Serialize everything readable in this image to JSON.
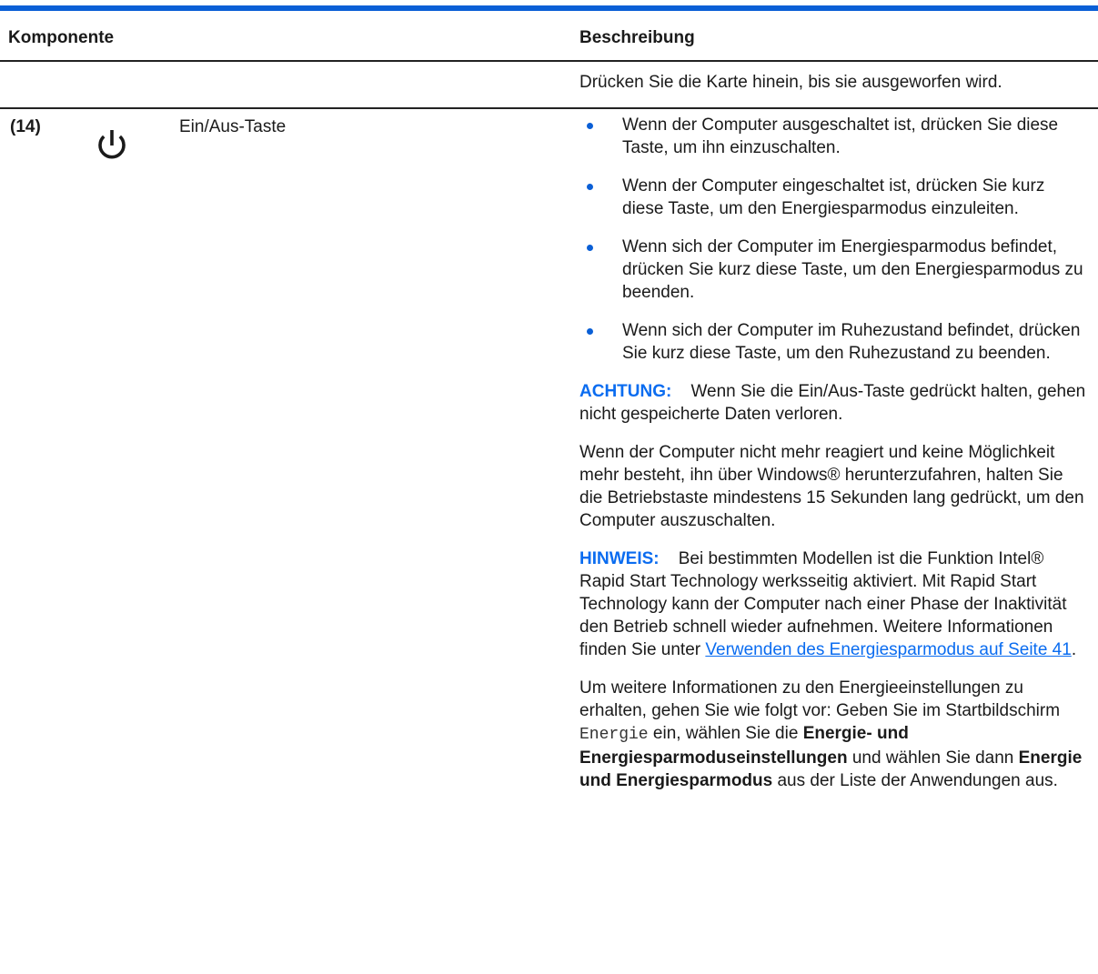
{
  "table": {
    "header": {
      "component": "Komponente",
      "description": "Beschreibung"
    },
    "intro_row": {
      "description": "Drücken Sie die Karte hinein, bis sie ausgeworfen wird."
    },
    "row": {
      "number": "(14)",
      "icon": "power-icon",
      "name": "Ein/Aus-Taste",
      "bullets": [
        "Wenn der Computer ausgeschaltet ist, drücken Sie diese Taste, um ihn einzuschalten.",
        "Wenn der Computer eingeschaltet ist, drücken Sie kurz diese Taste, um den Energiesparmodus einzuleiten.",
        "Wenn sich der Computer im Energiesparmodus befindet, drücken Sie kurz diese Taste, um den Energiesparmodus zu beenden.",
        "Wenn sich der Computer im Ruhezustand befindet, drücken Sie kurz diese Taste, um den Ruhezustand zu beenden."
      ],
      "caution": {
        "label": "ACHTUNG:",
        "text": "Wenn Sie die Ein/Aus-Taste gedrückt halten, gehen nicht gespeicherte Daten verloren."
      },
      "unresponsive_paragraph": "Wenn der Computer nicht mehr reagiert und keine Möglichkeit mehr besteht, ihn über Windows® herunterzufahren, halten Sie die Betriebstaste mindestens 15 Sekunden lang gedrückt, um den Computer auszuschalten.",
      "note": {
        "label": "HINWEIS:",
        "text": "Bei bestimmten Modellen ist die Funktion Intel® Rapid Start Technology werksseitig aktiviert. Mit Rapid Start Technology kann der Computer nach einer Phase der Inaktivität den Betrieb schnell wieder aufnehmen. Weitere Informationen finden Sie unter",
        "link": "Verwenden des Energiesparmodus auf Seite 41",
        "after_link": "."
      },
      "settings_paragraph": {
        "part1": "Um weitere Informationen zu den Energieeinstellungen zu erhalten, gehen Sie wie folgt vor: Geben Sie im Startbildschirm",
        "code": "Energie",
        "part2": "ein, wählen Sie die",
        "bold1": "Energie- und Energiesparmoduseinstellungen",
        "part3": "und wählen Sie dann",
        "bold2": "Energie und Energiesparmodus",
        "part4": "aus der Liste der Anwendungen aus."
      }
    }
  },
  "colors": {
    "accent": "#0a5fd6",
    "label_blue": "#0a6cf0",
    "rule": "#222222"
  }
}
